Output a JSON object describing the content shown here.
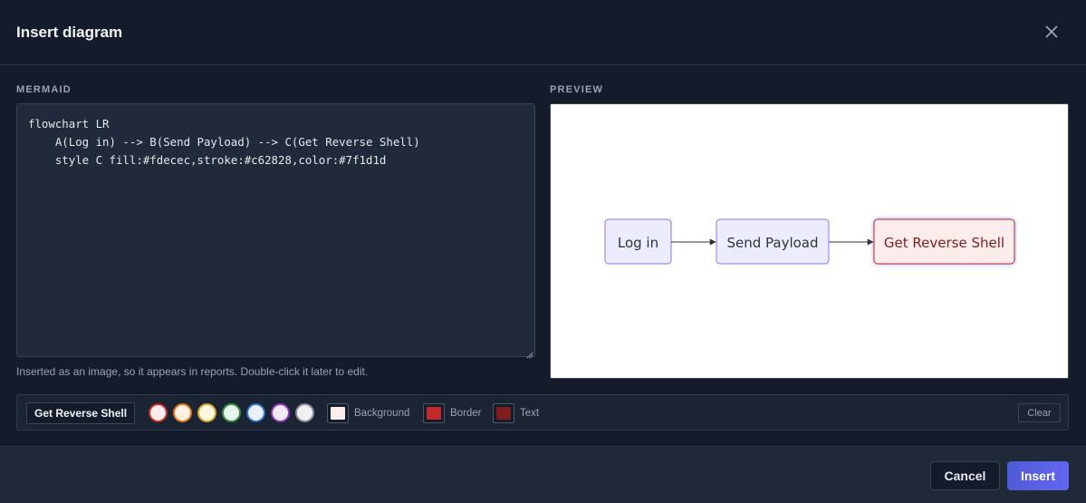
{
  "dialog": {
    "title": "Insert diagram",
    "close_icon": "close-icon"
  },
  "mermaid": {
    "label": "MERMAID",
    "code": "flowchart LR\n    A(Log in) --> B(Send Payload) --> C(Get Reverse Shell)\n    style C fill:#fdecec,stroke:#c62828,color:#7f1d1d",
    "hint": "Inserted as an image, so it appears in reports. Double-click it later to edit."
  },
  "preview": {
    "label": "PREVIEW",
    "nodes": [
      {
        "id": "A",
        "label": "Log in",
        "fill": "#ECECFF",
        "stroke": "#9370DB",
        "color": "#333333"
      },
      {
        "id": "B",
        "label": "Send Payload",
        "fill": "#ECECFF",
        "stroke": "#9370DB",
        "color": "#333333"
      },
      {
        "id": "C",
        "label": "Get Reverse Shell",
        "fill": "#fdecec",
        "stroke": "#c62828",
        "color": "#7f1d1d"
      }
    ],
    "edges": [
      {
        "from": "A",
        "to": "B"
      },
      {
        "from": "B",
        "to": "C"
      }
    ]
  },
  "style_toolbar": {
    "selected_node": "Get Reverse Shell",
    "swatches": [
      {
        "name": "red",
        "fill": "#fdecec",
        "stroke": "#c62828"
      },
      {
        "name": "orange",
        "fill": "#fef1e4",
        "stroke": "#e8741c"
      },
      {
        "name": "yellow",
        "fill": "#fdf6dc",
        "stroke": "#d4a72c"
      },
      {
        "name": "green",
        "fill": "#e8f5ea",
        "stroke": "#3d8b4a"
      },
      {
        "name": "blue",
        "fill": "#e7f0fb",
        "stroke": "#2f6fc4"
      },
      {
        "name": "purple",
        "fill": "#f2e8f8",
        "stroke": "#8a3fb8"
      },
      {
        "name": "gray",
        "fill": "#f1f1f3",
        "stroke": "#8b8e96"
      }
    ],
    "background_label": "Background",
    "background_color": "#fdecec",
    "border_label": "Border",
    "border_color": "#c62828",
    "text_label": "Text",
    "text_color": "#7f1d1d",
    "clear_label": "Clear"
  },
  "footer": {
    "cancel_label": "Cancel",
    "insert_label": "Insert"
  }
}
